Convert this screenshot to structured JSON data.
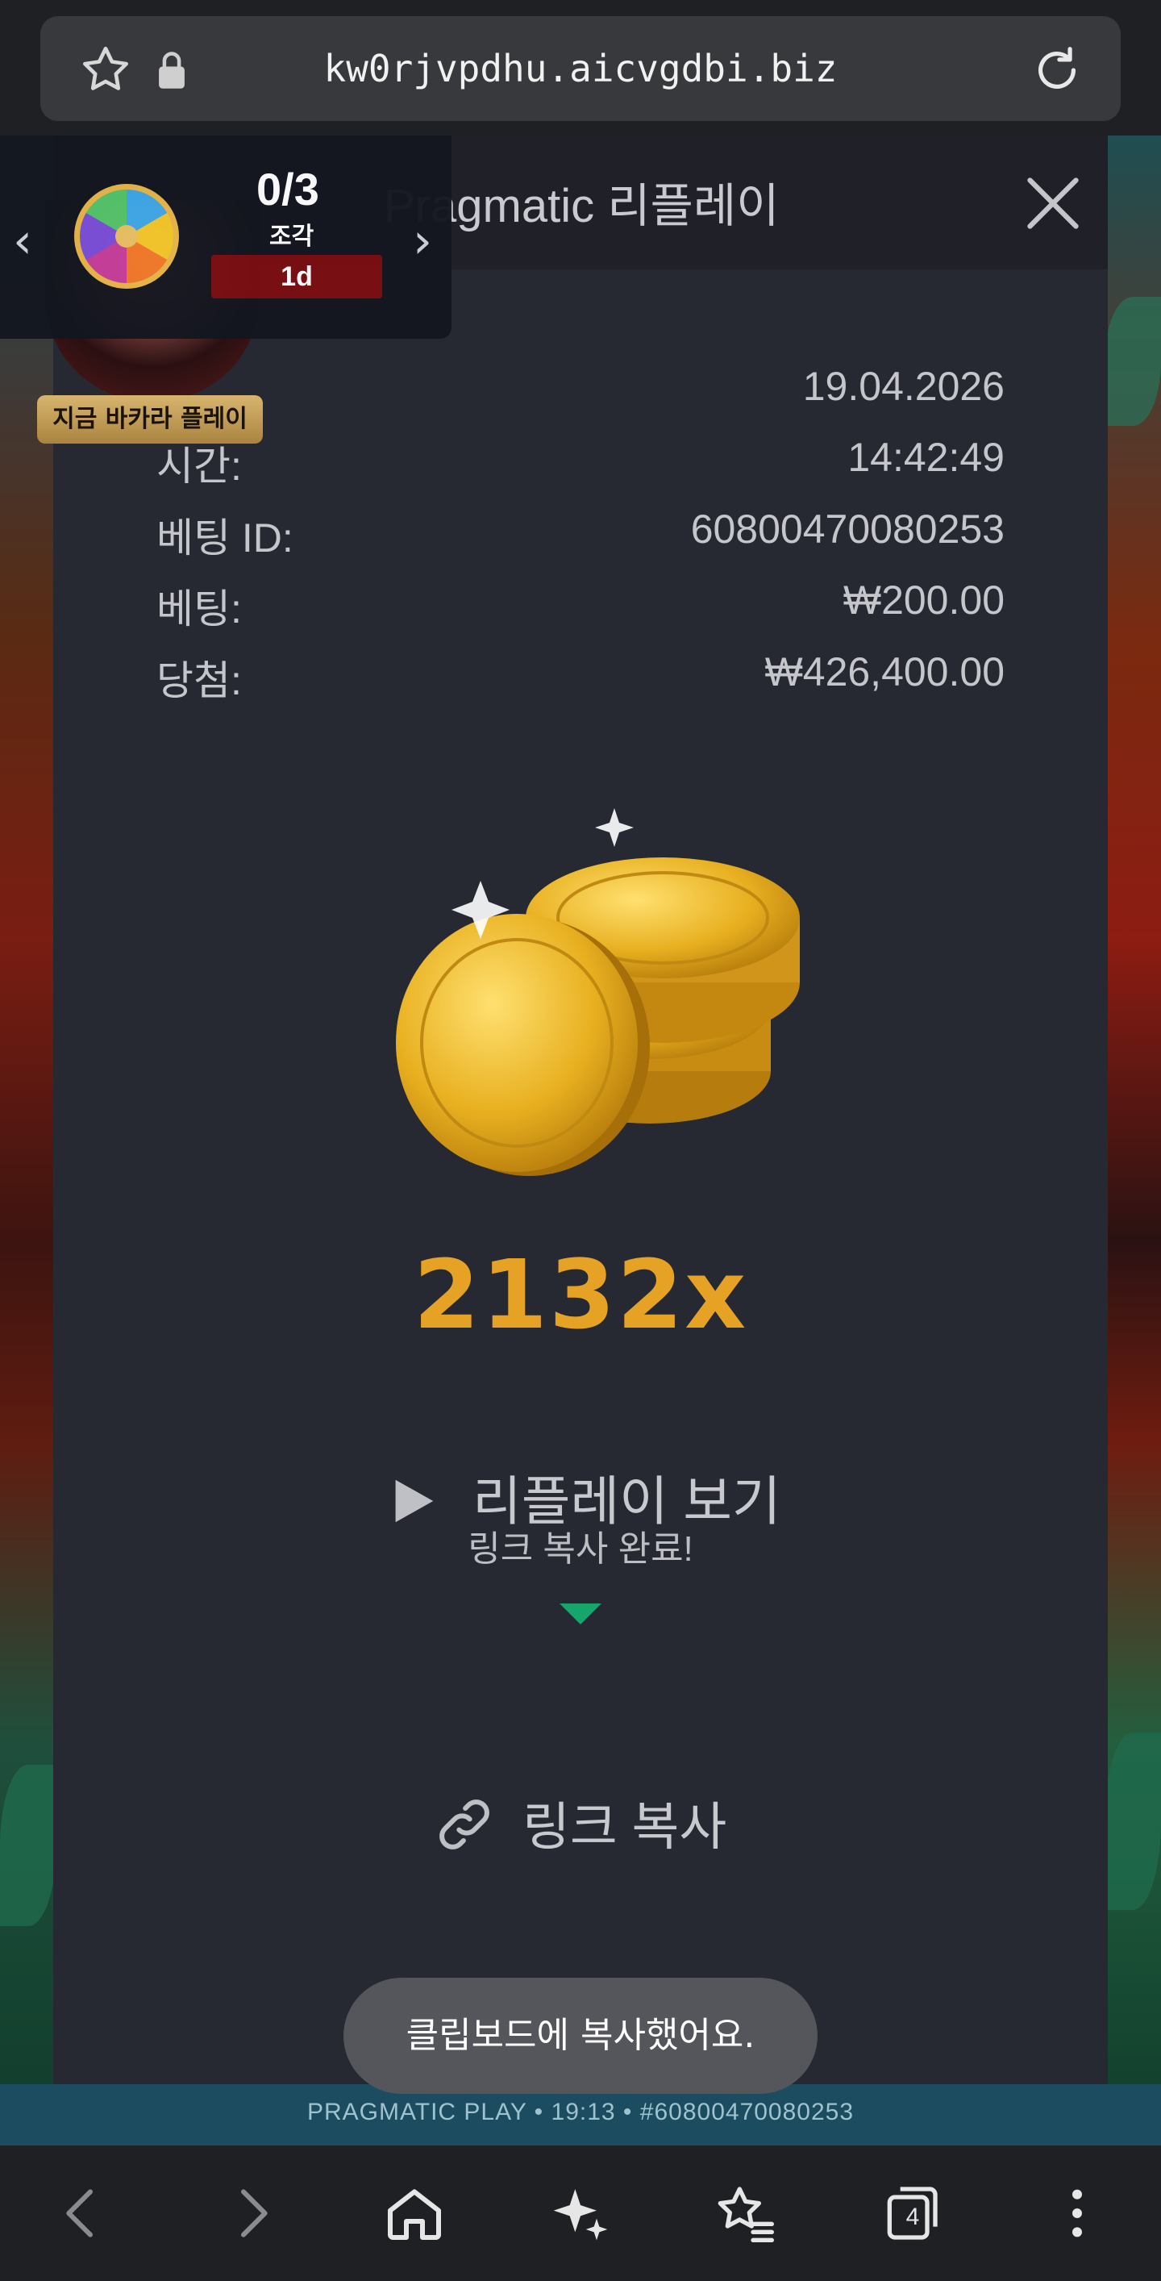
{
  "browser": {
    "url": "kw0rjvpdhu.aicvgdbi.biz",
    "icons": [
      "star-outline-icon",
      "lock-icon",
      "reload-icon"
    ]
  },
  "widget": {
    "fraction": "0/3",
    "fraction_label": "조각",
    "timer": "1d",
    "prev_icon": "chevron-left-icon",
    "next_icon": "chevron-right-icon",
    "baccarat_button": "지금 바카라 플레이"
  },
  "modal": {
    "title": "Pragmatic 리플레이",
    "rows": [
      {
        "label": "",
        "value": "19.04.2026"
      },
      {
        "label": "시간:",
        "value": "14:42:49"
      },
      {
        "label": "베팅 ID:",
        "value": "60800470080253"
      },
      {
        "label": "베팅:",
        "value": "₩200.00"
      },
      {
        "label": "당첨:",
        "value": "₩426,400.00"
      }
    ],
    "multiplier": "2132x",
    "replay_label": "리플레이 보기",
    "copied_tooltip": "링크 복사 완료!",
    "copy_link_label": "링크 복사"
  },
  "toast": "클립보드에 복사했어요.",
  "game_strip": "PRAGMATIC PLAY • 19:13 • #60800470080253",
  "navbar": {
    "tabs_count": "4",
    "icons": [
      "back-icon",
      "forward-icon",
      "home-icon",
      "sparkle-icon",
      "bookmarks-icon",
      "tabs-icon",
      "more-icon"
    ]
  },
  "colors": {
    "modal_bg": "#272932",
    "accent_gold": "#e6a225",
    "tooltip_green": "#16a56a",
    "timer_red": "#7a0f12"
  }
}
